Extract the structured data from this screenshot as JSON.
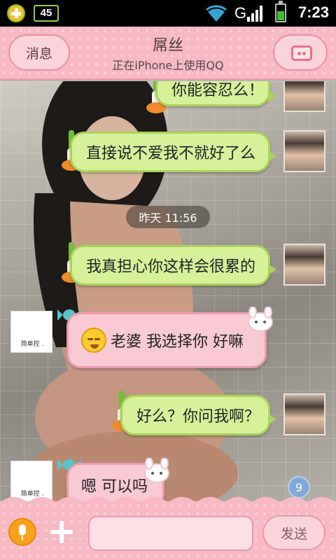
{
  "status_bar": {
    "sd_label": "45",
    "network_label": "G",
    "time": "7:23"
  },
  "header": {
    "back_label": "消息",
    "title": "屌丝",
    "subtitle": "正在iPhone上使用QQ"
  },
  "messages": [
    {
      "sender": "me",
      "text": "你能容忍么！"
    },
    {
      "sender": "me",
      "text": "直接说不爱我不就好了么"
    },
    {
      "sender": "me",
      "text": "我真担心你这样会很累的"
    },
    {
      "sender": "friend",
      "text": "老婆 我选择你 好嘛"
    },
    {
      "sender": "me",
      "text": "好么？你问我啊？"
    },
    {
      "sender": "friend",
      "text": "嗯 可以吗"
    }
  ],
  "timestamp": "昨天 11:56",
  "friend_avatar_label": "简单控 .",
  "unread_count": "9",
  "input": {
    "send_label": "发送"
  },
  "icons": [
    "plus-icon",
    "sd-card-icon",
    "wifi-icon",
    "signal-icon",
    "battery-icon",
    "pig-face-icon",
    "mic-icon",
    "leek-icon",
    "candy-icon",
    "bunny-icon",
    "emoji-face-icon"
  ],
  "colors": {
    "header_pink": "#f7b9c4",
    "outgoing_bubble": "#d6f19a",
    "incoming_bubble": "#f9c9d4",
    "mic_orange": "#f7a21a"
  }
}
